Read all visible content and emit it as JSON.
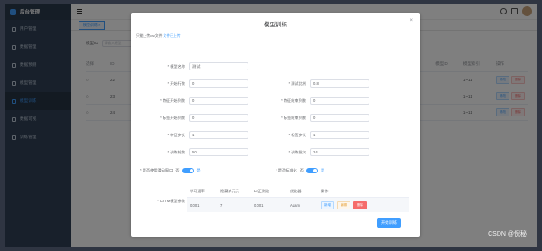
{
  "sidebar": {
    "title": "后台管理",
    "items": [
      {
        "label": "用户管理"
      },
      {
        "label": "数据管理"
      },
      {
        "label": "数据预测"
      },
      {
        "label": "模型管理"
      },
      {
        "label": "模型训练"
      },
      {
        "label": "数据可视"
      },
      {
        "label": "训练管理"
      }
    ]
  },
  "tagsview": {
    "tag": "模型训练 ×"
  },
  "background": {
    "search_label": "模型ID",
    "search_placeholder": "请输入模型",
    "headers": [
      "选择",
      "ID",
      "模型ID",
      "模型索引",
      "操作"
    ],
    "rows": [
      {
        "id": "22",
        "range": "1~11"
      },
      {
        "id": "23",
        "range": "1~11"
      },
      {
        "id": "24",
        "range": "1~11"
      }
    ],
    "btn_edit": "修改",
    "btn_delete": "删除"
  },
  "dialog": {
    "title": "模型训练",
    "close": "×",
    "upload_tip": "只能上传csv文件",
    "upload_link": "文件已上传",
    "fields": {
      "model_name": {
        "label": "* 模型名称",
        "value": "测试"
      },
      "start_row": {
        "label": "* 开始行数",
        "value": "0"
      },
      "test_ratio": {
        "label": "* 测试比例",
        "value": "0.8"
      },
      "feat_start_col": {
        "label": "* 特征开始列数",
        "value": "0"
      },
      "feat_end_col": {
        "label": "* 特征结束列数",
        "value": "0"
      },
      "label_start_col": {
        "label": "* 标签开始列数",
        "value": "0"
      },
      "label_end_col": {
        "label": "* 标签结束列数",
        "value": "0"
      },
      "feat_step": {
        "label": "* 特征步长",
        "value": "1"
      },
      "label_step": {
        "label": "* 标签步长",
        "value": "1"
      },
      "epochs": {
        "label": "* 训练轮数",
        "value": "50"
      },
      "batch": {
        "label": "* 训练批次",
        "value": "24"
      }
    },
    "switch_window": {
      "label": "* 是否使用滑动窗口",
      "off": "否",
      "on": "是"
    },
    "switch_normalize": {
      "label": "* 是否标准化",
      "off": "否",
      "on": "是"
    },
    "lstm": {
      "label": "* LSTM模型参数",
      "headers": [
        "学习速率",
        "隐藏单元元",
        "L2正则化",
        "优化器",
        "操作"
      ],
      "row": {
        "lr": "0.001",
        "hidden": "7",
        "l2": "0.001",
        "optimizer": "Adam"
      },
      "btn_add": "新增",
      "btn_edit": "编辑",
      "btn_del": "删除"
    },
    "submit": "开始训练"
  },
  "watermark": "CSDN @倪秘",
  "colors": {
    "primary": "#409eff",
    "danger": "#f56c6c",
    "sidebar": "#304156"
  }
}
